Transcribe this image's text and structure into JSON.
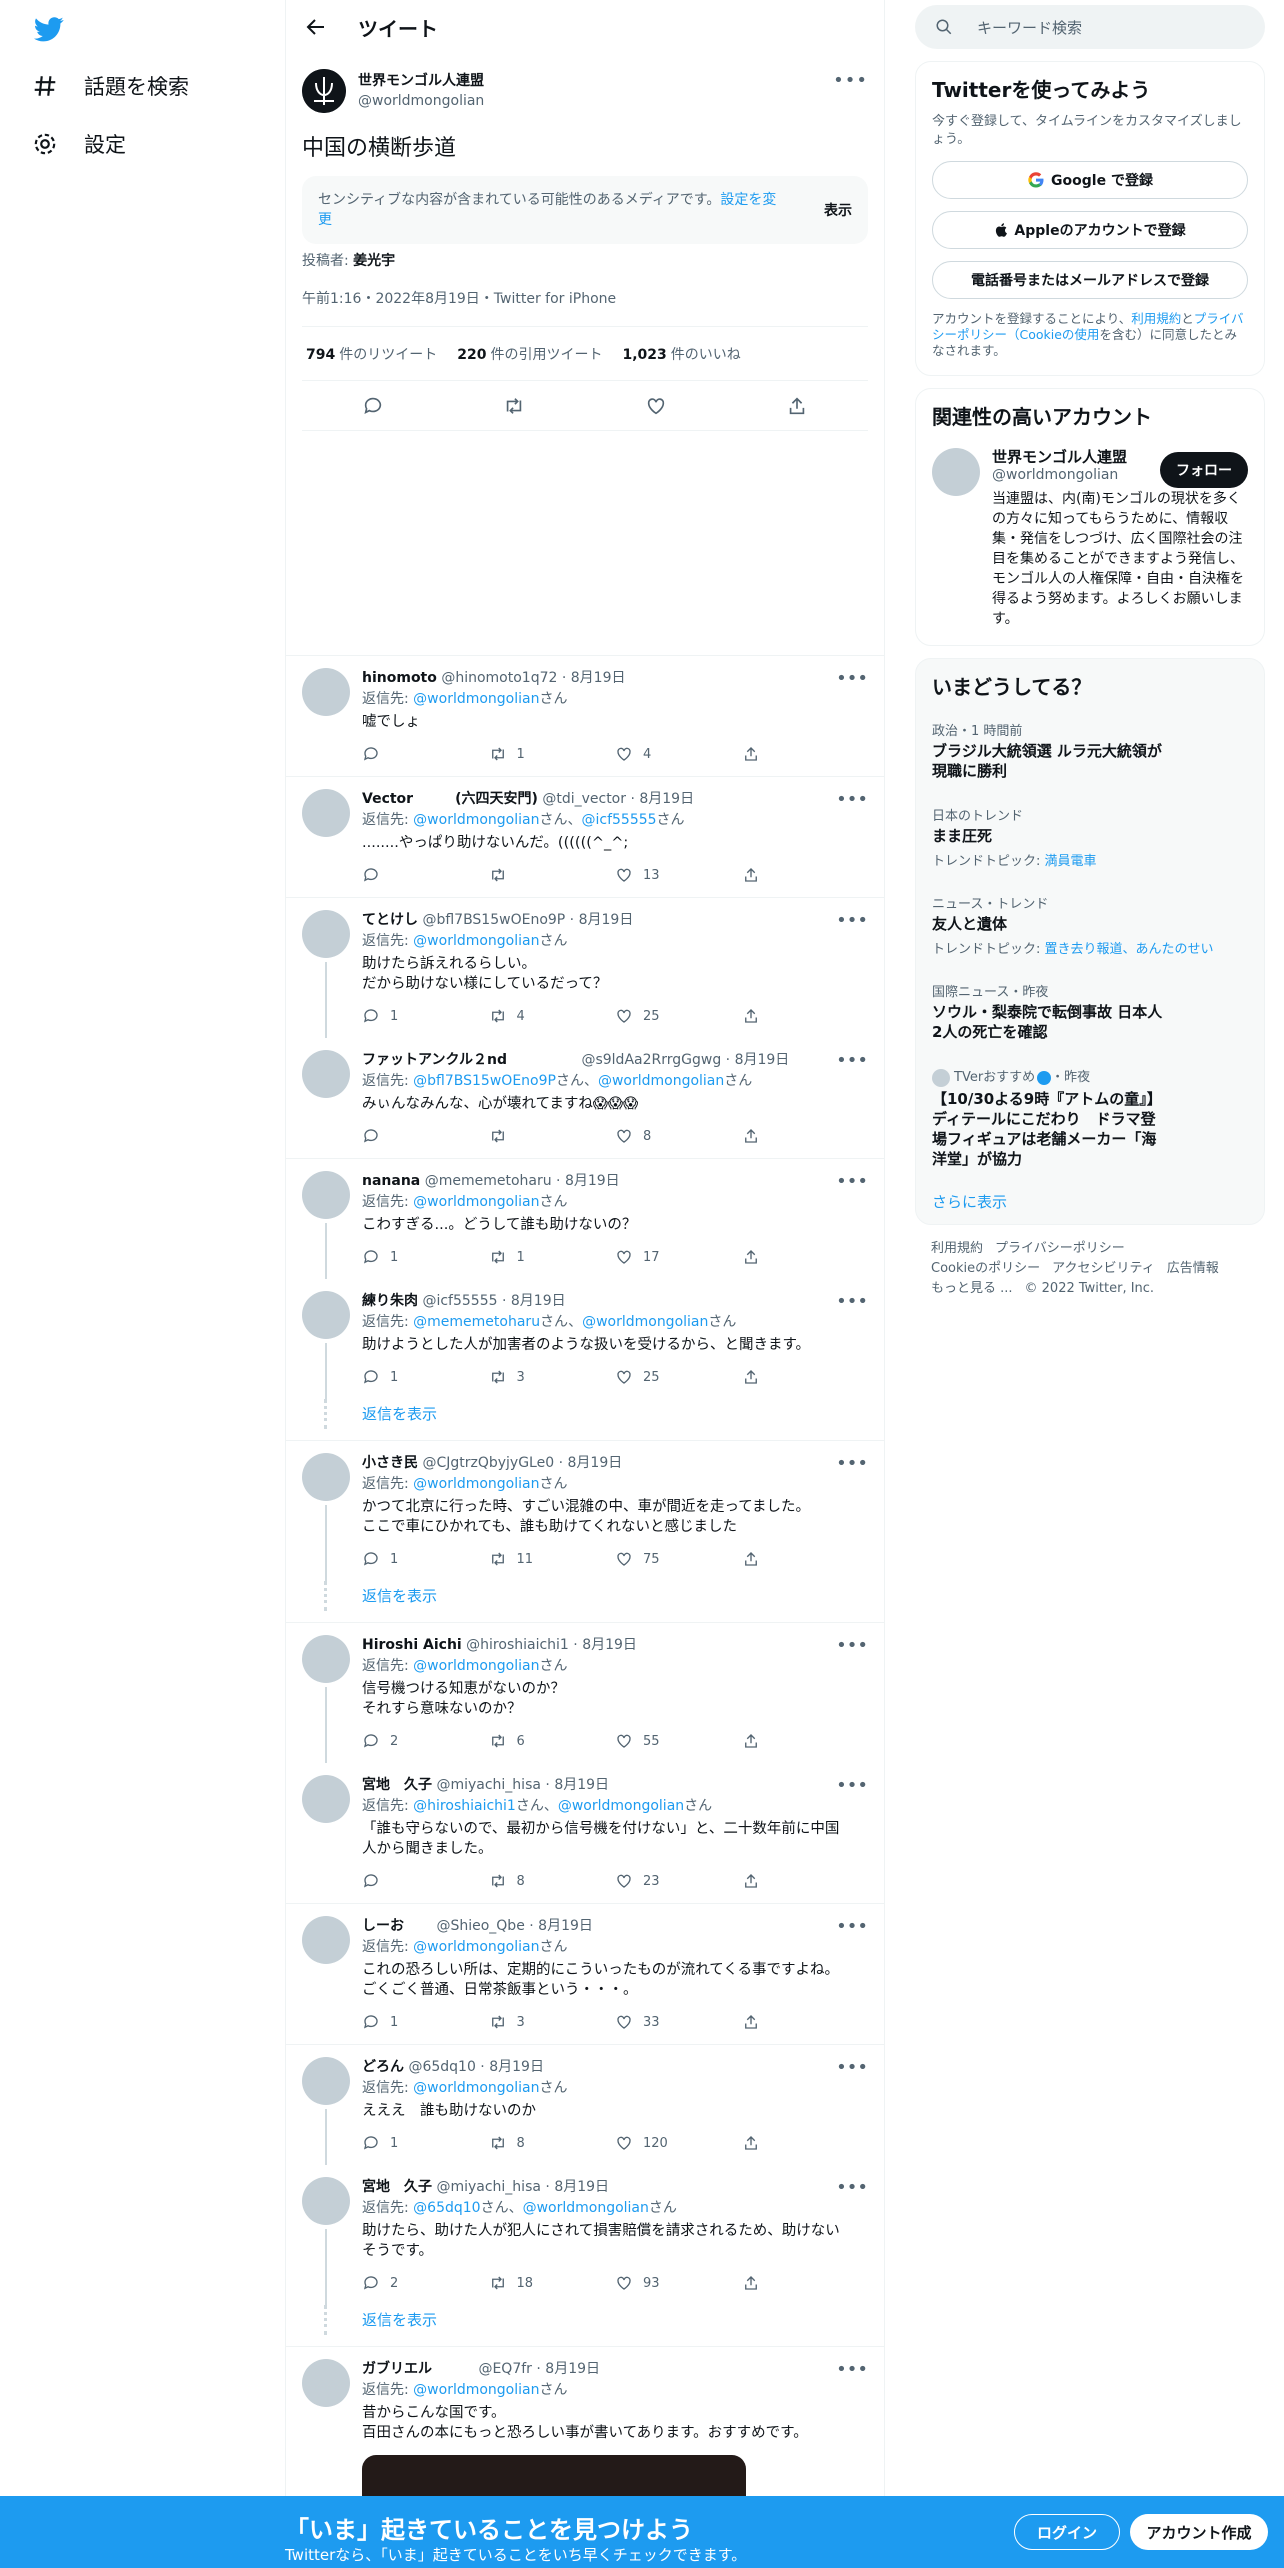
{
  "nav": {
    "explore": "話題を検索",
    "settings": "設定"
  },
  "header": {
    "title": "ツイート"
  },
  "tweet": {
    "name": "世界モンゴル人連盟",
    "handle": "@worldmongolian",
    "text": "中国の横断歩道",
    "sensitive_msg": "センシティブな内容が含まれている可能性のあるメディアです。",
    "sensitive_link": "設定を変更",
    "show": "表示",
    "poster_label": "投稿者:",
    "poster_name": "姜光宇",
    "meta": "午前1:16・2022年8月19日・Twitter for iPhone",
    "retweets": "794",
    "retweets_label": "件のリツイート",
    "quotes": "220",
    "quotes_label": "件の引用ツイート",
    "likes": "1,023",
    "likes_label": "件のいいね"
  },
  "replies": [
    {
      "name": "hinomoto",
      "handle": "@hinomoto1q72",
      "date": "8月19日",
      "to": [
        "@worldmongolian"
      ],
      "text": [
        "嘘でしょ"
      ],
      "reply": "",
      "rt": "1",
      "like": "4",
      "thread": false,
      "showreplies": ""
    },
    {
      "name": "Vector　　　(六四天安門)",
      "handle": "@tdi_vector",
      "date": "8月19日",
      "to": [
        "@worldmongolian",
        "@icf55555"
      ],
      "text": [
        "........やっぱり助けないんだ。((((((^_^;"
      ],
      "reply": "",
      "rt": "",
      "like": "13",
      "thread": false,
      "showreplies": ""
    },
    {
      "name": "てとけし",
      "handle": "@bfl7BS15wOEno9P",
      "date": "8月19日",
      "to": [
        "@worldmongolian"
      ],
      "text": [
        "助けたら訴えれるらしい。",
        "だから助けない様にしているだって？"
      ],
      "reply": "1",
      "rt": "4",
      "like": "25",
      "thread": true,
      "showreplies": ""
    },
    {
      "name": "ファットアンクル２nd　　　　　",
      "handle": "@s9ldAa2RrrgGgwg",
      "date": "8月19日",
      "to": [
        "@bfl7BS15wOEno9P",
        "@worldmongolian"
      ],
      "text": [
        "みぃんなみんな、心が壊れてますね😱😱😱"
      ],
      "reply": "",
      "rt": "",
      "like": "8",
      "thread": false,
      "showreplies": ""
    },
    {
      "name": "nanana",
      "handle": "@mememetoharu",
      "date": "8月19日",
      "to": [
        "@worldmongolian"
      ],
      "text": [
        "こわすぎる...。どうして誰も助けないの？"
      ],
      "reply": "1",
      "rt": "1",
      "like": "17",
      "thread": true,
      "showreplies": ""
    },
    {
      "name": "練り朱肉",
      "handle": "@icf55555",
      "date": "8月19日",
      "to": [
        "@mememetoharu",
        "@worldmongolian"
      ],
      "text": [
        "助けようとした人が加害者のような扱いを受けるから、と聞きます。"
      ],
      "reply": "1",
      "rt": "3",
      "like": "25",
      "thread": true,
      "showreplies": "返信を表示"
    },
    {
      "name": "小さき民",
      "handle": "@CJgtrzQbyjyGLe0",
      "date": "8月19日",
      "to": [
        "@worldmongolian"
      ],
      "text": [
        "かつて北京に行った時、すごい混雑の中、車が間近を走ってました。",
        "ここで車にひかれても、誰も助けてくれないと感じました"
      ],
      "reply": "1",
      "rt": "11",
      "like": "75",
      "thread": true,
      "showreplies": "返信を表示"
    },
    {
      "name": "Hiroshi Aichi",
      "handle": "@hiroshiaichi1",
      "date": "8月19日",
      "to": [
        "@worldmongolian"
      ],
      "text": [
        "信号機つける知恵がないのか？",
        "それすら意味ないのか？"
      ],
      "reply": "2",
      "rt": "6",
      "like": "55",
      "thread": true,
      "showreplies": ""
    },
    {
      "name": "宮地　久子",
      "handle": "@miyachi_hisa",
      "date": "8月19日",
      "to": [
        "@hiroshiaichi1",
        "@worldmongolian"
      ],
      "text": [
        "「誰も守らないので、最初から信号機を付けない」と、二十数年前に中国",
        "人から聞きました。"
      ],
      "reply": "",
      "rt": "8",
      "like": "23",
      "thread": false,
      "showreplies": ""
    },
    {
      "name": "しーお　　",
      "handle": "@Shieo_Qbe",
      "date": "8月19日",
      "to": [
        "@worldmongolian"
      ],
      "text": [
        "これの恐ろしい所は、定期的にこういったものが流れてくる事ですよね。",
        "ごくごく普通、日常茶飯事という・・・。"
      ],
      "reply": "1",
      "rt": "3",
      "like": "33",
      "thread": false,
      "showreplies": ""
    },
    {
      "name": "どろん",
      "handle": "@65dq10",
      "date": "8月19日",
      "to": [
        "@worldmongolian"
      ],
      "text": [
        "えええ　誰も助けないのか"
      ],
      "reply": "1",
      "rt": "8",
      "like": "120",
      "thread": true,
      "showreplies": ""
    },
    {
      "name": "宮地　久子",
      "handle": "@miyachi_hisa",
      "date": "8月19日",
      "to": [
        "@65dq10",
        "@worldmongolian"
      ],
      "text": [
        "助けたら、助けた人が犯人にされて損害賠償を請求されるため、助けない",
        "そうです。"
      ],
      "reply": "2",
      "rt": "18",
      "like": "93",
      "thread": true,
      "showreplies": "返信を表示"
    },
    {
      "name": "ガブリエル　　　",
      "handle": "@EQ7fr",
      "date": "8月19日",
      "to": [
        "@worldmongolian"
      ],
      "text": [
        "昔からこんな国です。",
        "百田さんの本にもっと恐ろしい事が書いてあります。おすすめです。"
      ],
      "reply": "",
      "rt": "",
      "like": "",
      "thread": false,
      "showreplies": "",
      "media": true
    }
  ],
  "common": {
    "reply_to": "返信先:",
    "san": "さん",
    "and": "、"
  },
  "search": {
    "placeholder": "キーワード検索"
  },
  "signup": {
    "title": "Twitterを使ってみよう",
    "sub": "今すぐ登録して、タイムラインをカスタマイズしましょう。",
    "google": "Google で登録",
    "apple": "Appleのアカウントで登録",
    "phone": "電話番号またはメールアドレスで登録",
    "legal1": "アカウントを登録することにより、",
    "legal_link1": "利用規約",
    "legal2": "と",
    "legal_link2": "プライバシーポリシー（Cookieの使用",
    "legal3": "を含む）に同意したとみなされます。"
  },
  "related": {
    "title": "関連性の高いアカウント",
    "name": "世界モンゴル人連盟",
    "handle": "@worldmongolian",
    "follow": "フォロー",
    "bio": "当連盟は、内(南)モンゴルの現状を多くの方々に知ってもらうために、情報収集・発信をしつづけ、広く国際社会の注目を集めることができますよう発信し、モンゴル人の人権保障・自由・自決権を得るよう努めます。よろしくお願いします。"
  },
  "trends": {
    "title": "いまどうしてる？",
    "items": [
      {
        "ctx": "政治・1 時間前",
        "title": "ブラジル大統領選 ルラ元大統領が\n現職に勝利",
        "topic_label": "",
        "topic": ""
      },
      {
        "ctx": "日本のトレンド",
        "title": "まま圧死",
        "topic_label": "トレンドトピック: ",
        "topic": "満員電車"
      },
      {
        "ctx": "ニュース・トレンド",
        "title": "友人と遺体",
        "topic_label": "トレンドトピック: ",
        "topic": "置き去り報道、あんたのせい"
      },
      {
        "ctx": "国際ニュース・昨夜",
        "title": "ソウル・梨泰院で転倒事故 日本人\n2人の死亡を確認",
        "topic_label": "",
        "topic": ""
      },
      {
        "ctx": "TVerおすすめ",
        "ctx2": "・昨夜",
        "title": "【10/30よる9時『アトムの童』】\nディテールにこだわり　ドラマ登\n場フィギュアは老舗メーカー「海\n洋堂」が協力",
        "topic_label": "",
        "topic": ""
      }
    ],
    "more": "さらに表示"
  },
  "footer": {
    "l1": [
      "利用規約",
      "プライバシーポリシー"
    ],
    "l2": [
      "Cookieのポリシー",
      "アクセシビリティ",
      "広告情報"
    ],
    "l3": [
      "もっと見る ...",
      "© 2022 Twitter, Inc."
    ]
  },
  "bottom": {
    "title": "「いま」起きていることを見つけよう",
    "sub": "Twitterなら、「いま」起きていることをいち早くチェックできます。",
    "login": "ログイン",
    "create": "アカウント作成"
  },
  "colors": {
    "accent": "#1d9bf0",
    "text": "#0f1419",
    "muted": "#536471"
  }
}
